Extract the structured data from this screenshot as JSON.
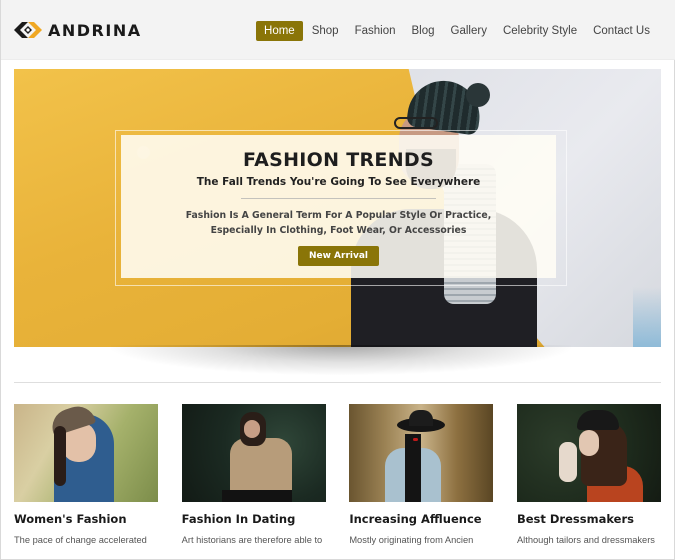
{
  "brand": {
    "name": "ANDRINA",
    "logo_icon": "diamond-arrows-logo-icon",
    "accent_color": "#8a7508",
    "logo_colors": [
      "#1a1a1a",
      "#f0a823"
    ]
  },
  "nav": {
    "items": [
      {
        "label": "Home",
        "active": true
      },
      {
        "label": "Shop",
        "active": false
      },
      {
        "label": "Fashion",
        "active": false
      },
      {
        "label": "Blog",
        "active": false
      },
      {
        "label": "Gallery",
        "active": false
      },
      {
        "label": "Celebrity Style",
        "active": false
      },
      {
        "label": "Contact Us",
        "active": false
      }
    ]
  },
  "hero": {
    "title": "FASHION TRENDS",
    "subtitle": "The Fall Trends You're Going To See Everywhere",
    "description": "Fashion Is A General Term For A Popular Style Or Practice, Especially In Clothing, Foot Wear, Or Accessories",
    "button_label": "New Arrival",
    "image_alt": "Man in beanie and scarf against yellow and white wall"
  },
  "cards": [
    {
      "title": "Women's Fashion",
      "text": "The pace of change accelerated",
      "image_alt": "Woman in cap and denim jacket"
    },
    {
      "title": "Fashion In Dating",
      "text": "Art historians are therefore able to",
      "image_alt": "Bearded man in beige jacket"
    },
    {
      "title": "Increasing Affluence",
      "text": "Mostly originating from Ancien",
      "image_alt": "Woman in black hat in forest"
    },
    {
      "title": "Best Dressmakers",
      "text": "Although tailors and dressmakers",
      "image_alt": "Woman in hat and red coat"
    }
  ]
}
